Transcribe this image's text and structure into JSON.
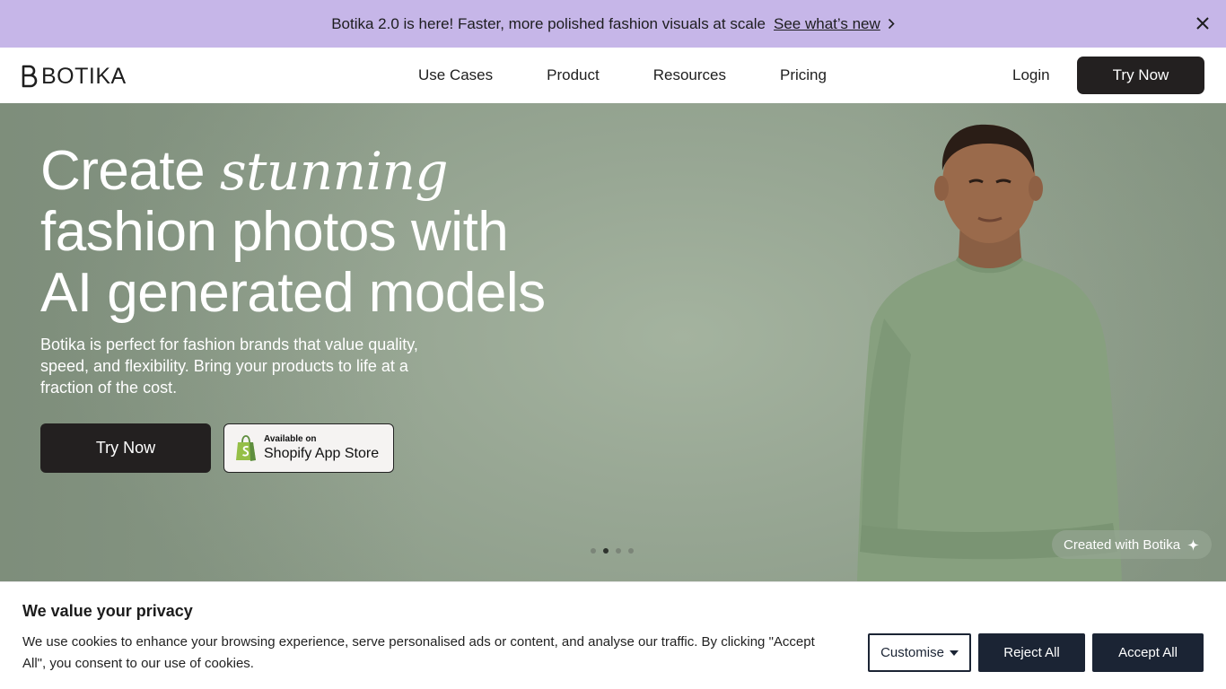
{
  "announcement": {
    "message": "Botika 2.0 is here! Faster, more polished fashion visuals at scale",
    "link_label": "See what’s new",
    "icons": {
      "chevron": "chevron-right-icon",
      "close": "close-icon"
    },
    "background_color": "#c6b6e8"
  },
  "nav": {
    "logo_text": "BOTIKA",
    "links": [
      {
        "label": "Use Cases"
      },
      {
        "label": "Product"
      },
      {
        "label": "Resources"
      },
      {
        "label": "Pricing"
      }
    ],
    "login_label": "Login",
    "cta_label": "Try Now"
  },
  "hero": {
    "headline_1a": "Create ",
    "headline_1b": "stunning",
    "headline_2": "fashion photos with",
    "headline_3": "AI generated models",
    "subtitle": "Botika is perfect for fashion brands that value quality, speed, and flexibility. Bring your products to life at a fraction of the cost.",
    "cta_label": "Try Now",
    "shopify": {
      "small_label": "Available on",
      "big_label": "Shopify App Store",
      "icon": "shopify-bag-icon"
    },
    "carousel": {
      "count": 4,
      "active_index": 1
    },
    "badge_label": "Created with Botika",
    "badge_icon": "sparkle-icon",
    "background_color": "#98a794"
  },
  "cookie": {
    "title": "We value your privacy",
    "text": "We use cookies to enhance your browsing experience, serve personalised ads or content, and analyse our traffic. By clicking \"Accept All\", you consent to our use of cookies.",
    "customise_label": "Customise",
    "reject_label": "Reject All",
    "accept_label": "Accept All",
    "button_color": "#1b2434"
  }
}
